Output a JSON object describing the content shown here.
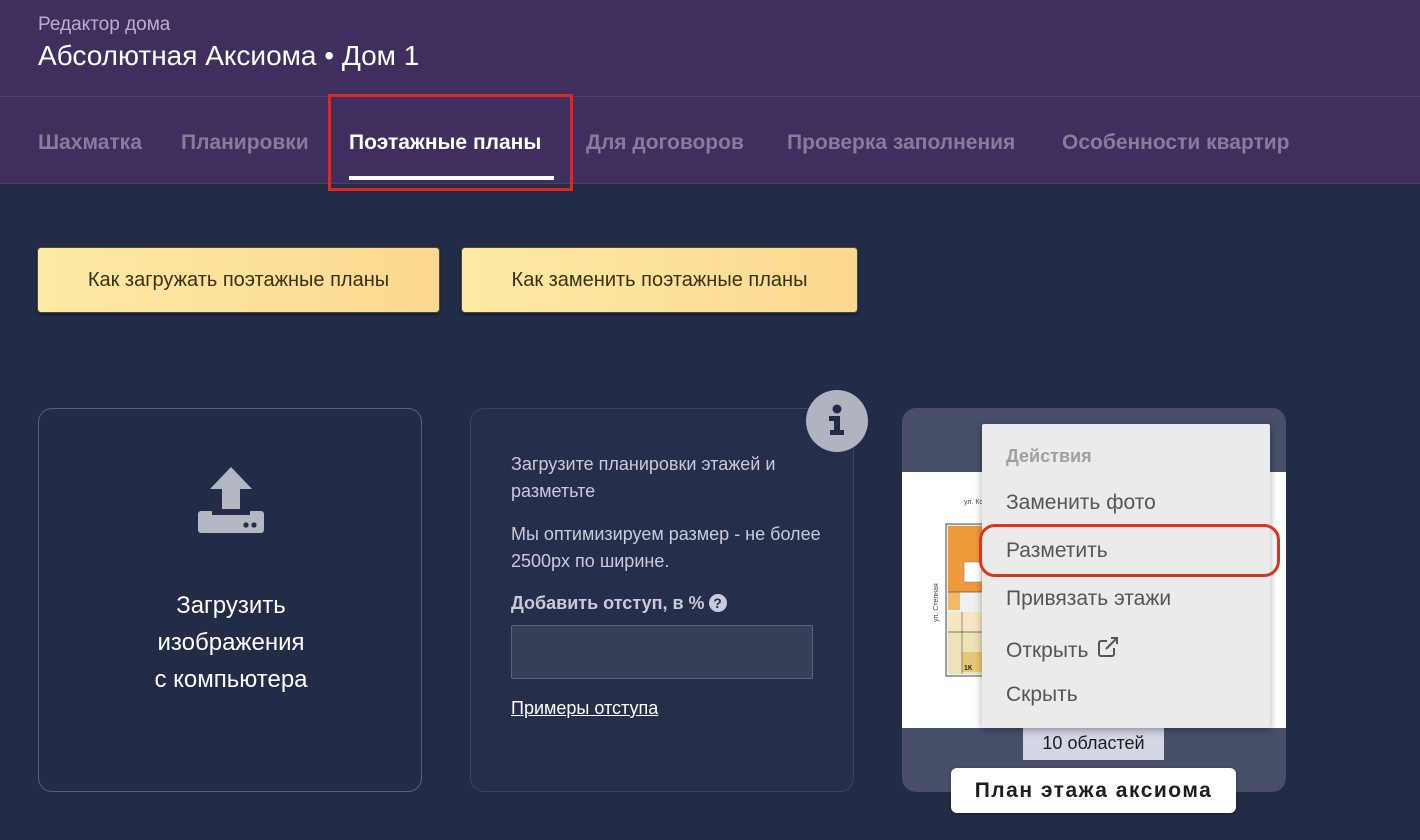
{
  "header": {
    "subtitle": "Редактор дома",
    "title": "Абсолютная Аксиома • Дом 1"
  },
  "tabs": [
    {
      "label": "Шахматка",
      "active": false
    },
    {
      "label": "Планировки",
      "active": false
    },
    {
      "label": "Поэтажные планы",
      "active": true
    },
    {
      "label": "Для договоров",
      "active": false
    },
    {
      "label": "Проверка заполнения",
      "active": false
    },
    {
      "label": "Особенности квартир",
      "active": false
    }
  ],
  "help_buttons": {
    "upload_how": "Как загружать поэтажные планы",
    "replace_how": "Как заменить поэтажные планы"
  },
  "upload_card": {
    "line1": "Загрузить",
    "line2": "изображения",
    "line3": "с компьютера",
    "icon": "upload-icon"
  },
  "info_card": {
    "paragraph1": "Загрузите планировки этажей и разметьте",
    "paragraph2": "Мы оптимизируем размер - не более 2500px по ширине.",
    "indent_label": "Добавить отступ, в %",
    "indent_help_icon": "question-circle-icon",
    "indent_value": "",
    "examples_link": "Примеры отступа",
    "info_icon": "info-icon"
  },
  "plan_card": {
    "regions": "10 областей",
    "name": "План этажа аксиома",
    "street_top": "ул. Ко...",
    "street_side": "ул. Степная",
    "apt_label": "1К"
  },
  "context_menu": {
    "header": "Действия",
    "items": {
      "replace_photo": "Заменить фото",
      "mark_up": "Разметить",
      "bind_floors": "Привязать этажи",
      "open": "Открыть",
      "hide": "Скрыть"
    },
    "open_icon": "external-link-icon"
  },
  "colors": {
    "header_bg": "#3f2f5e",
    "page_bg": "#232c47",
    "highlight_red": "#e0271d",
    "help_button": "#fde4a0"
  }
}
